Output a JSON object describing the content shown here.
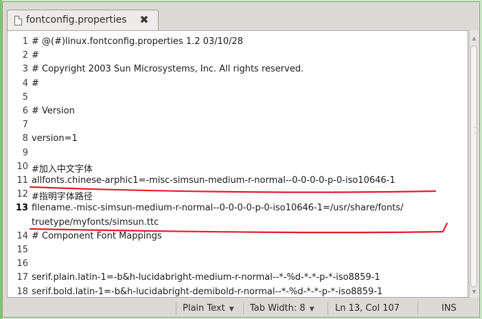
{
  "tab": {
    "title": "fontconfig.properties",
    "close_glyph": "✖",
    "icon": "document-icon"
  },
  "editor": {
    "current_line": 13,
    "lines": [
      {
        "num": "1",
        "text": "# @(#)linux.fontconfig.properties  1.2 03/10/28"
      },
      {
        "num": "2",
        "text": "#"
      },
      {
        "num": "3",
        "text": "# Copyright 2003 Sun Microsystems, Inc. All rights reserved."
      },
      {
        "num": "4",
        "text": "#"
      },
      {
        "num": "5",
        "text": ""
      },
      {
        "num": "6",
        "text": "# Version"
      },
      {
        "num": "7",
        "text": ""
      },
      {
        "num": "8",
        "text": "version=1"
      },
      {
        "num": "9",
        "text": ""
      },
      {
        "num": "10",
        "text": "#加入中文字体"
      },
      {
        "num": "11",
        "text": "allfonts.chinese-arphic1=-misc-simsun-medium-r-normal--0-0-0-0-p-0-iso10646-1"
      },
      {
        "num": "12",
        "text": "#指明字体路径"
      },
      {
        "num": "13",
        "text": "filename.-misc-simsun-medium-r-normal--0-0-0-0-p-0-iso10646-1=/usr/share/fonts/"
      },
      {
        "num": "",
        "text": "truetype/myfonts/simsun.ttc"
      },
      {
        "num": "14",
        "text": "# Component Font Mappings"
      },
      {
        "num": "15",
        "text": ""
      },
      {
        "num": "16",
        "text": ""
      },
      {
        "num": "17",
        "text": "serif.plain.latin-1=-b&h-lucidabright-medium-r-normal--*-%d-*-*-p-*-iso8859-1"
      },
      {
        "num": "18",
        "text": "serif.bold.latin-1=-b&h-lucidabright-demibold-r-normal--*-%d-*-*-p-*-iso8859-1"
      }
    ]
  },
  "statusbar": {
    "syntax": "Plain Text",
    "tab_width": "Tab Width:  8",
    "position": "Ln 13, Col 107",
    "mode": "INS",
    "dropdown_glyph": "▼"
  },
  "colors": {
    "background": "#c8e9c3",
    "underline": "#e8182b"
  }
}
